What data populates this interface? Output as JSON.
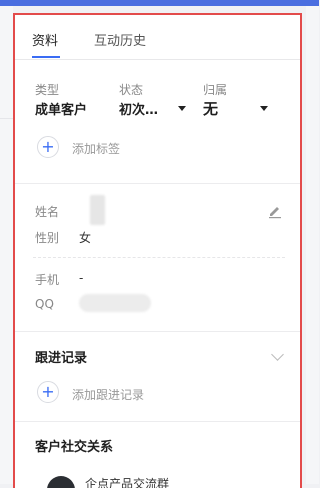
{
  "tabs": [
    {
      "label": "资料",
      "active": true
    },
    {
      "label": "互动历史",
      "active": false
    }
  ],
  "summary": {
    "type_label": "类型",
    "type_value": "成单客户",
    "status_label": "状态",
    "status_value": "初次…",
    "owner_label": "归属",
    "owner_value": "无"
  },
  "add_tag": "添加标签",
  "info": {
    "name_label": "姓名",
    "gender_label": "性别",
    "gender_value": "女",
    "phone_label": "手机",
    "phone_value": "-",
    "qq_label": "QQ"
  },
  "followup": {
    "title": "跟进记录",
    "add_label": "添加跟进记录"
  },
  "social": {
    "title": "客户社交关系",
    "group_name": "企点产品交流群"
  },
  "colors": {
    "accent": "#3a6cf4",
    "highlight_border": "#e34b4b",
    "top_bar": "#4a6ee0"
  }
}
